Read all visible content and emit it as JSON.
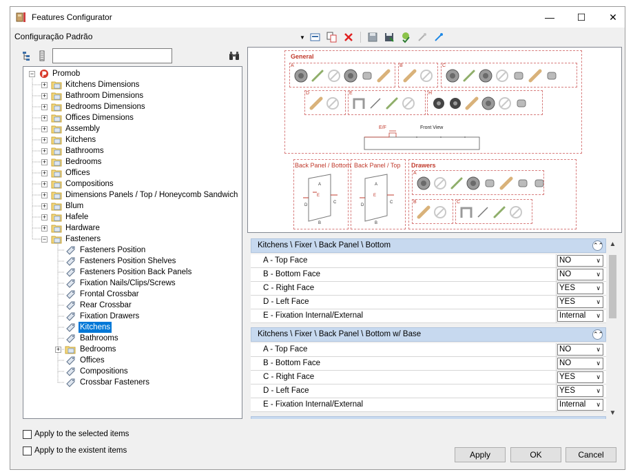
{
  "window": {
    "title": "Features Configurator",
    "minimize_glyph": "—",
    "maximize_glyph": "☐",
    "close_glyph": "✕"
  },
  "header": {
    "config_label": "Configuração Padrão"
  },
  "toolbar": {
    "icons": [
      "dropdown-arrow-icon",
      "insert-icon",
      "copy-icon",
      "delete-icon",
      "save-icon",
      "save-as-icon",
      "check-icon",
      "link-icon",
      "unlink-icon"
    ]
  },
  "search": {
    "value": "",
    "placeholder": ""
  },
  "tree": {
    "root": "Promob",
    "categories": [
      "Kitchens Dimensions",
      "Bathroom Dimensions",
      "Bedrooms Dimensions",
      "Offices Dimensions",
      "Assembly",
      "Kitchens",
      "Bathrooms",
      "Bedrooms",
      "Offices",
      "Compositions",
      "Dimensions Panels / Top / Honeycomb Sandwich",
      "Blum",
      "Hafele",
      "Hardware",
      "Fasteners"
    ],
    "fasteners_children": [
      "Fasteners Position",
      "Fasteners Position Shelves",
      "Fasteners Position Back Panels",
      "Fixation Nails/Clips/Screws",
      "Frontal Crossbar",
      "Rear Crossbar",
      "Fixation Drawers",
      "Kitchens",
      "Bathrooms",
      "Bedrooms",
      "Offices",
      "Compositions",
      "Crossbar Fasteners"
    ],
    "selected": "Kitchens"
  },
  "preview": {
    "general_label": "General",
    "front_view_label": "Front View",
    "ef_label": "E/F",
    "back_panel_bottom_label": "Back Panel / Bottom",
    "back_panel_top_label": "Back Panel / Top",
    "drawers_label": "Drawers",
    "letters": [
      "A",
      "B",
      "C",
      "D",
      "E",
      "F",
      "H"
    ]
  },
  "groups": [
    {
      "title": "Kitchens \\ Fixer \\ Back Panel \\ Bottom",
      "rows": [
        {
          "name": "A - Top Face",
          "value": "NO"
        },
        {
          "name": "B - Bottom Face",
          "value": "NO"
        },
        {
          "name": "C - Right Face",
          "value": "YES"
        },
        {
          "name": "D - Left Face",
          "value": "YES"
        },
        {
          "name": "E - Fixation Internal/External",
          "value": "Internal"
        }
      ]
    },
    {
      "title": "Kitchens \\ Fixer \\ Back Panel \\ Bottom w/ Base",
      "rows": [
        {
          "name": "A - Top Face",
          "value": "NO"
        },
        {
          "name": "B - Bottom Face",
          "value": "NO"
        },
        {
          "name": "C - Right Face",
          "value": "YES"
        },
        {
          "name": "D - Left Face",
          "value": "YES"
        },
        {
          "name": "E - Fixation Internal/External",
          "value": "Internal"
        }
      ]
    }
  ],
  "options": {
    "apply_selected": "Apply to the selected items",
    "apply_existent": "Apply to the existent items"
  },
  "buttons": {
    "apply": "Apply",
    "ok": "OK",
    "cancel": "Cancel"
  },
  "colors": {
    "selection": "#0078d7",
    "group_header": "#c7d9ef",
    "preview_accent": "#c0392b"
  }
}
